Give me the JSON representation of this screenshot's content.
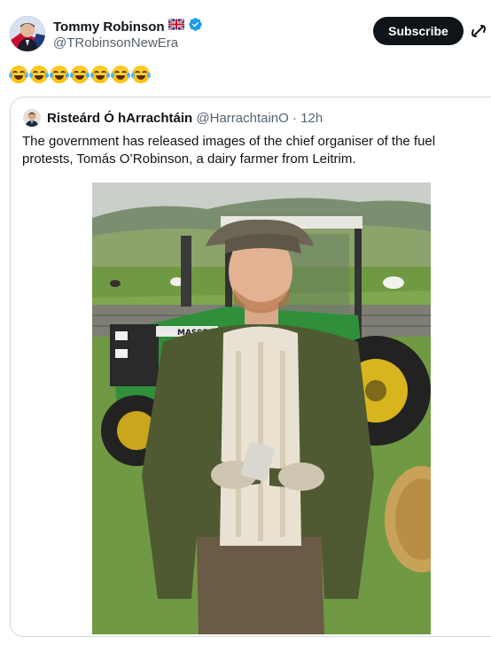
{
  "author": {
    "display_name": "Tommy Robinson",
    "flag": "🇬🇧",
    "handle": "@TRobinsonNewEra"
  },
  "actions": {
    "subscribe_label": "Subscribe",
    "grok_icon": "grok-icon"
  },
  "tweet": {
    "emoji_count": 7,
    "emoji_name": "face-with-tears-of-joy"
  },
  "quoted": {
    "display_name": "Risteárd Ó hArrachtáin",
    "handle": "@HarrachtainO",
    "separator": "·",
    "time": "12h",
    "text": "The government has released images of the chief organiser of the fuel protests, Tomás O’Robinson, a dairy farmer from Leitrim.",
    "image": {
      "tractor_badge": "MASSE"
    }
  },
  "colors": {
    "text": "#0f1419",
    "secondary": "#536471",
    "verified": "#1d9bf0",
    "border": "#cfd9de",
    "button_bg": "#0f1419"
  }
}
